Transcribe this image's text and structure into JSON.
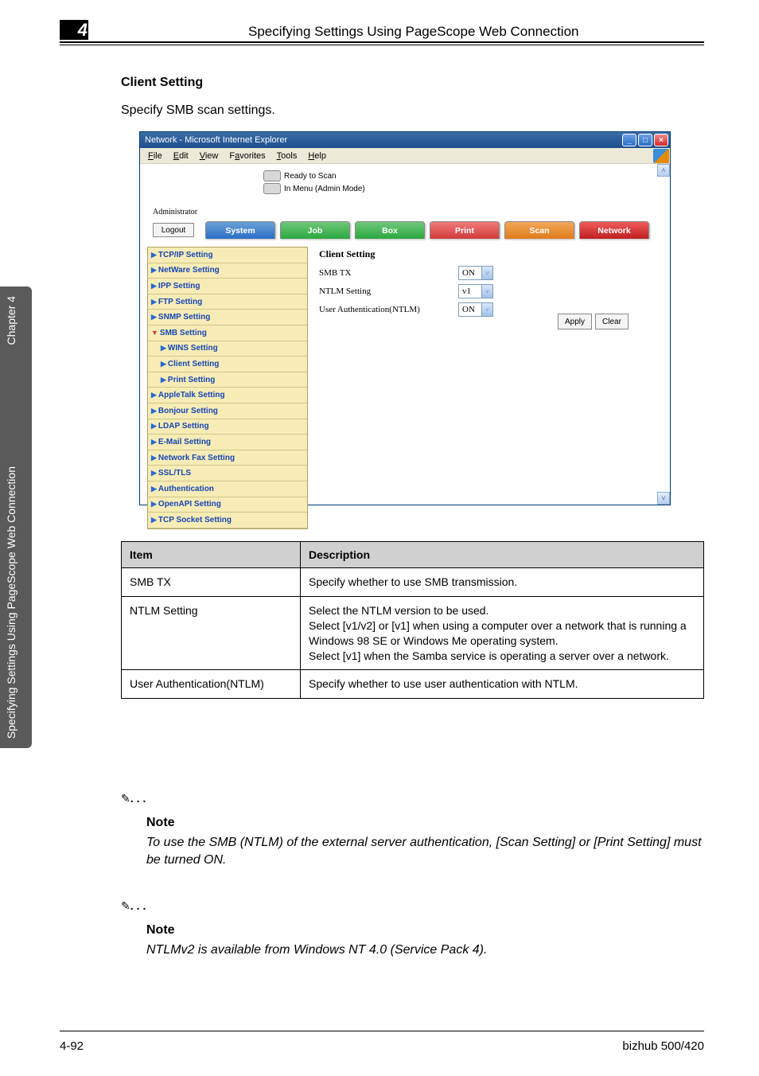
{
  "side_tab": {
    "main": "Specifying Settings Using PageScope Web Connection",
    "chapter": "Chapter 4"
  },
  "chapter_num": "4",
  "doc_title": "Specifying Settings Using PageScope Web Connection",
  "section_title": "Client Setting",
  "section_sub": "Specify SMB scan settings.",
  "browser": {
    "title": "Network - Microsoft Internet Explorer",
    "menu": [
      "File",
      "Edit",
      "View",
      "Favorites",
      "Tools",
      "Help"
    ],
    "menu_underline": [
      "F",
      "E",
      "V",
      "a",
      "T",
      "H"
    ],
    "status_ready": "Ready to Scan",
    "status_menu": "In Menu (Admin Mode)",
    "admin": "Administrator",
    "logout": "Logout",
    "tabs": [
      "System",
      "Job",
      "Box",
      "Print",
      "Scan",
      "Network"
    ],
    "sidebar_items": [
      "TCP/IP Setting",
      "NetWare Setting",
      "IPP Setting",
      "FTP Setting",
      "SNMP Setting",
      "SMB Setting",
      "WINS Setting",
      "Client Setting",
      "Print Setting",
      "AppleTalk Setting",
      "Bonjour Setting",
      "LDAP Setting",
      "E-Mail Setting",
      "Network Fax Setting",
      "SSL/TLS",
      "Authentication",
      "OpenAPI Setting",
      "TCP Socket Setting"
    ],
    "content_title": "Client Setting",
    "rows": [
      {
        "label": "SMB TX",
        "value": "ON"
      },
      {
        "label": "NTLM Setting",
        "value": "v1"
      },
      {
        "label": "User Authentication(NTLM)",
        "value": "ON"
      }
    ],
    "apply": "Apply",
    "clear": "Clear"
  },
  "table": {
    "h1": "Item",
    "h2": "Description",
    "rows": [
      {
        "item": "SMB TX",
        "desc": "Specify whether to use SMB transmission."
      },
      {
        "item": "NTLM Setting",
        "desc": "Select the NTLM version to be used.\nSelect [v1/v2] or [v1] when using a computer over a network that is running a Windows 98 SE or Windows Me operating system.\nSelect [v1] when the Samba service is operating a server over a network."
      },
      {
        "item": "User Authentication(NTLM)",
        "desc": "Specify whether to use user authentication with NTLM."
      }
    ]
  },
  "note1": {
    "title": "Note",
    "body": "To use the SMB (NTLM) of the external server authentication, [Scan Setting] or [Print Setting] must be turned ON."
  },
  "note2": {
    "title": "Note",
    "body": "NTLMv2 is available from Windows NT 4.0 (Service Pack 4)."
  },
  "footer_left": "4-92",
  "footer_right": "bizhub 500/420"
}
